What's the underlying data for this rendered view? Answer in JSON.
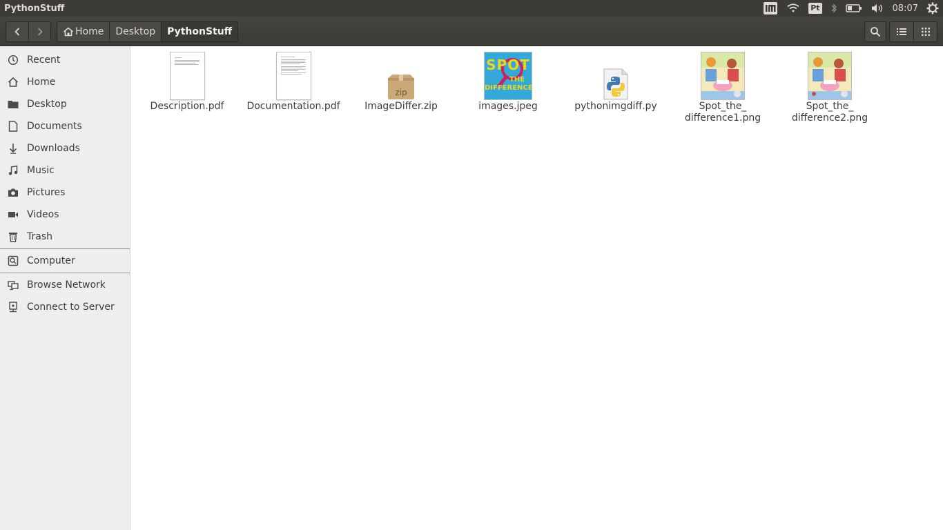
{
  "window": {
    "title": "PythonStuff"
  },
  "panel": {
    "keyboard_indicator": "Pt",
    "clock": "08:07"
  },
  "toolbar": {
    "breadcrumbs": [
      {
        "label": "Home",
        "icon": "home-icon"
      },
      {
        "label": "Desktop"
      },
      {
        "label": "PythonStuff",
        "active": true
      }
    ]
  },
  "sidebar": {
    "places": [
      {
        "label": "Recent",
        "icon": "clock-icon"
      },
      {
        "label": "Home",
        "icon": "home-icon"
      },
      {
        "label": "Desktop",
        "icon": "folder-icon"
      },
      {
        "label": "Documents",
        "icon": "document-icon"
      },
      {
        "label": "Downloads",
        "icon": "download-icon"
      },
      {
        "label": "Music",
        "icon": "music-icon"
      },
      {
        "label": "Pictures",
        "icon": "camera-icon"
      },
      {
        "label": "Videos",
        "icon": "video-icon"
      },
      {
        "label": "Trash",
        "icon": "trash-icon"
      }
    ],
    "devices": [
      {
        "label": "Computer",
        "icon": "computer-icon"
      }
    ],
    "network": [
      {
        "label": "Browse Network",
        "icon": "network-icon"
      },
      {
        "label": "Connect to Server",
        "icon": "server-icon"
      }
    ]
  },
  "files": [
    {
      "name": "Description.pdf",
      "type": "pdf"
    },
    {
      "name": "Documentation.pdf",
      "type": "pdf"
    },
    {
      "name": "ImageDiffer.zip",
      "type": "zip",
      "badge": "zip"
    },
    {
      "name": "images.jpeg",
      "type": "jpeg",
      "thumb_text_top": "SPOT",
      "thumb_text_mid": "THE",
      "thumb_text_bottom": "DIFFERENCE"
    },
    {
      "name": "pythonimgdiff.py",
      "type": "python"
    },
    {
      "name": "Spot_the_\ndifference1.png",
      "type": "png"
    },
    {
      "name": "Spot_the_\ndifference2.png",
      "type": "png"
    }
  ],
  "colors": {
    "panel_bg": "#3c3b37",
    "sidebar_bg": "#efeeed",
    "text": "#3c3c3c"
  }
}
